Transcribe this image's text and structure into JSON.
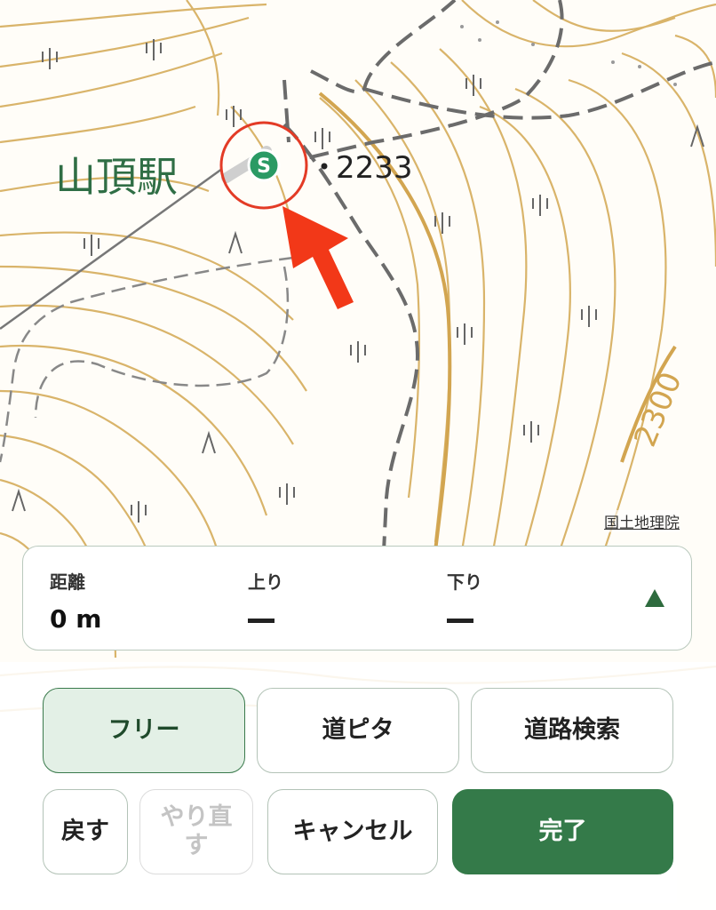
{
  "map": {
    "station_name": "山頂駅",
    "spot_height": "2233",
    "contour_label": "2300",
    "start_marker": "S",
    "attribution": "国土地理院",
    "colors": {
      "contour": "#d9b46a",
      "station": "#2f6e45",
      "marker": "#2a9a64",
      "arrow": "#f23818",
      "circle": "#e33b26"
    }
  },
  "stats": {
    "distance_label": "距離",
    "distance_value": "0 m",
    "ascent_label": "上り",
    "ascent_value": "—",
    "descent_label": "下り",
    "descent_value": "—"
  },
  "modes": {
    "free": "フリー",
    "snap": "道ピタ",
    "road_search": "道路検索",
    "selected": "free"
  },
  "actions": {
    "undo": "戻す",
    "redo": "やり直す",
    "cancel": "キャンセル",
    "done": "完了"
  }
}
